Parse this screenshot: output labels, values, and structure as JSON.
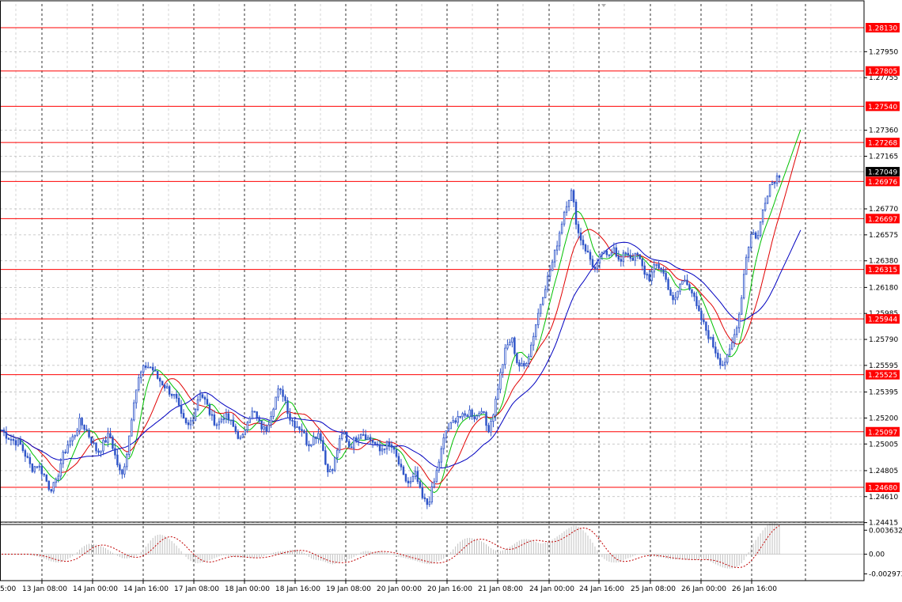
{
  "chart_data": {
    "type": "candlestick",
    "instrument_title": "",
    "price_axis_ticks": [
      "1.27950",
      "1.27755",
      "1.27360",
      "1.27165",
      "1.26770",
      "1.26575",
      "1.26380",
      "1.26180",
      "1.25985",
      "1.25790",
      "1.25595",
      "1.25395",
      "1.25200",
      "1.25005",
      "1.24805",
      "1.24610",
      "1.24415"
    ],
    "oscillator_ticks": [
      "0.003632",
      "0.00",
      "-0.002973"
    ],
    "time_axis_labels": [
      "13 Jan 08:00",
      "14 Jan 00:00",
      "14 Jan 16:00",
      "17 Jan 08:00",
      "18 Jan 00:00",
      "18 Jan 16:00",
      "19 Jan 08:00",
      "20 Jan 00:00",
      "20 Jan 16:00",
      "21 Jan 08:00",
      "24 Jan 00:00",
      "24 Jan 16:00",
      "25 Jan 08:00",
      "26 Jan 00:00",
      "26 Jan 16:00"
    ],
    "first_partial_label": "5:00",
    "current_price": "1.27049",
    "levels": [
      "1.28130",
      "1.27805",
      "1.27540",
      "1.27268",
      "1.26976",
      "1.26697",
      "1.26315",
      "1.25944",
      "1.25525",
      "1.25097",
      "1.24680"
    ],
    "series": [
      {
        "name": "",
        "kind": "ohlc",
        "close_path": [
          [
            0,
            1.2511
          ],
          [
            5,
            1.2506
          ],
          [
            10,
            1.2503
          ],
          [
            15,
            1.2501
          ],
          [
            20,
            1.2492
          ],
          [
            25,
            1.2482
          ],
          [
            30,
            1.2485
          ],
          [
            35,
            1.2478
          ],
          [
            40,
            1.2467
          ],
          [
            45,
            1.247
          ],
          [
            50,
            1.2489
          ],
          [
            55,
            1.25
          ],
          [
            60,
            1.2506
          ],
          [
            65,
            1.2517
          ],
          [
            70,
            1.2512
          ],
          [
            75,
            1.2503
          ],
          [
            80,
            1.2494
          ],
          [
            85,
            1.2501
          ],
          [
            90,
            1.2508
          ],
          [
            95,
            1.249
          ],
          [
            100,
            1.2475
          ],
          [
            105,
            1.2497
          ],
          [
            110,
            1.2533
          ],
          [
            115,
            1.2552
          ],
          [
            120,
            1.2559
          ],
          [
            125,
            1.2558
          ],
          [
            130,
            1.255
          ],
          [
            135,
            1.2545
          ],
          [
            140,
            1.254
          ],
          [
            145,
            1.2535
          ],
          [
            150,
            1.252
          ],
          [
            155,
            1.2513
          ],
          [
            160,
            1.2522
          ],
          [
            165,
            1.254
          ],
          [
            170,
            1.2532
          ],
          [
            175,
            1.252
          ],
          [
            180,
            1.2515
          ],
          [
            185,
            1.2522
          ],
          [
            190,
            1.2518
          ],
          [
            195,
            1.251
          ],
          [
            200,
            1.2502
          ],
          [
            205,
            1.252
          ],
          [
            210,
            1.2525
          ],
          [
            215,
            1.2515
          ],
          [
            220,
            1.251
          ],
          [
            225,
            1.2525
          ],
          [
            230,
            1.254
          ],
          [
            235,
            1.2538
          ],
          [
            240,
            1.252
          ],
          [
            245,
            1.2515
          ],
          [
            250,
            1.2512
          ],
          [
            255,
            1.25
          ],
          [
            260,
            1.2505
          ],
          [
            265,
            1.251
          ],
          [
            270,
            1.2485
          ],
          [
            275,
            1.2478
          ],
          [
            280,
            1.2498
          ],
          [
            285,
            1.251
          ],
          [
            290,
            1.2498
          ],
          [
            295,
            1.2505
          ],
          [
            300,
            1.251
          ],
          [
            305,
            1.2505
          ],
          [
            310,
            1.2502
          ],
          [
            315,
            1.2495
          ],
          [
            320,
            1.25
          ],
          [
            325,
            1.2498
          ],
          [
            330,
            1.2488
          ],
          [
            335,
            1.2475
          ],
          [
            340,
            1.247
          ],
          [
            345,
            1.2478
          ],
          [
            350,
            1.246
          ],
          [
            355,
            1.2455
          ],
          [
            360,
            1.247
          ],
          [
            365,
            1.249
          ],
          [
            370,
            1.251
          ],
          [
            375,
            1.2515
          ],
          [
            380,
            1.2522
          ],
          [
            385,
            1.252
          ],
          [
            390,
            1.2525
          ],
          [
            395,
            1.252
          ],
          [
            400,
            1.2528
          ],
          [
            405,
            1.251
          ],
          [
            410,
            1.2525
          ],
          [
            415,
            1.255
          ],
          [
            420,
            1.2572
          ],
          [
            425,
            1.258
          ],
          [
            430,
            1.256
          ],
          [
            435,
            1.2558
          ],
          [
            440,
            1.257
          ],
          [
            445,
            1.259
          ],
          [
            450,
            1.261
          ],
          [
            455,
            1.2625
          ],
          [
            460,
            1.264
          ],
          [
            465,
            1.266
          ],
          [
            470,
            1.268
          ],
          [
            475,
            1.269
          ],
          [
            480,
            1.266
          ],
          [
            485,
            1.265
          ],
          [
            490,
            1.264
          ],
          [
            495,
            1.263
          ],
          [
            500,
            1.2645
          ],
          [
            505,
            1.264
          ],
          [
            510,
            1.265
          ],
          [
            515,
            1.2635
          ],
          [
            520,
            1.2645
          ],
          [
            525,
            1.264
          ],
          [
            530,
            1.2642
          ],
          [
            535,
            1.263
          ],
          [
            540,
            1.2625
          ],
          [
            545,
            1.2635
          ],
          [
            550,
            1.2632
          ],
          [
            555,
            1.262
          ],
          [
            560,
            1.2605
          ],
          [
            565,
            1.262
          ],
          [
            570,
            1.2625
          ],
          [
            575,
            1.2615
          ],
          [
            580,
            1.26
          ],
          [
            585,
            1.259
          ],
          [
            590,
            1.258
          ],
          [
            595,
            1.257
          ],
          [
            600,
            1.256
          ],
          [
            605,
            1.2565
          ],
          [
            610,
            1.258
          ],
          [
            615,
            1.26
          ],
          [
            620,
            1.264
          ],
          [
            625,
            1.266
          ],
          [
            630,
            1.2655
          ],
          [
            635,
            1.268
          ],
          [
            640,
            1.2695
          ],
          [
            645,
            1.27
          ],
          [
            650,
            1.2705
          ]
        ]
      },
      {
        "name": "",
        "kind": "ma",
        "color": "#00c000"
      },
      {
        "name": "",
        "kind": "ma",
        "color": "#e00000"
      },
      {
        "name": "",
        "kind": "ma",
        "color": "#0000c0"
      },
      {
        "name": "",
        "kind": "oscillator_histogram",
        "color": "#c0c0c0"
      },
      {
        "name": "",
        "kind": "oscillator_signal",
        "color": "#c00000"
      }
    ],
    "ylim": [
      1.2438,
      1.2836
    ],
    "oscillator_ylim": [
      -0.004,
      0.0045
    ],
    "grid": "dashed",
    "legend": "none"
  },
  "colors": {
    "candle": "#2f55c8",
    "level_line": "#ff0000",
    "level_label_bg": "#ff0000",
    "level_label_text": "#ffffff",
    "current_price_bg": "#000000",
    "grid": "#b8b8b8",
    "vgrid": "#000000",
    "ma_fast": "#00c000",
    "ma_mid": "#e00000",
    "ma_slow": "#0000c0"
  }
}
